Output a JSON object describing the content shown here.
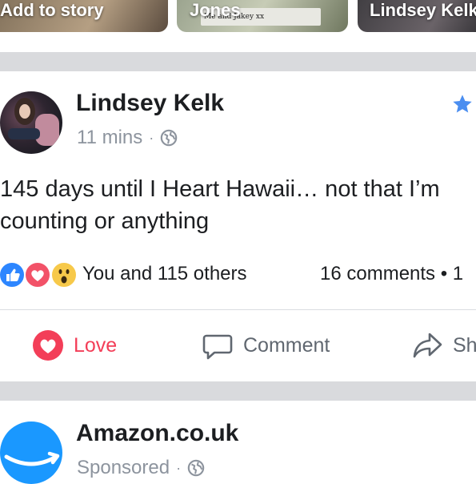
{
  "colors": {
    "separator": "#d9dadd",
    "meta_gray": "#8d949e",
    "love_red": "#f33e58",
    "like_blue": "#2d86ff",
    "star_blue": "#4b8ef0",
    "amazon_blue": "#1a98ff"
  },
  "stories": [
    {
      "label": "Add to story"
    },
    {
      "label": "Jones",
      "caption": "Me and Jakey xx"
    },
    {
      "label": "Lindsey Kelk"
    }
  ],
  "post": {
    "author": "Lindsey Kelk",
    "time": "11 mins",
    "dot": "·",
    "privacy_icon": "globe-icon",
    "favorite_icon": "star-icon",
    "text": "145 days until I Heart Hawaii… not that I’m counting or anything",
    "reactions": {
      "icons": [
        "like-icon",
        "love-icon",
        "wow-icon"
      ],
      "summary": "You and 115 others",
      "comments": "16 comments • 1"
    },
    "actions": {
      "love": "Love",
      "comment": "Comment",
      "share": "Sh"
    }
  },
  "post2": {
    "author": "Amazon.co.uk",
    "meta": "Sponsored",
    "dot": "·",
    "privacy_icon": "globe-icon"
  }
}
